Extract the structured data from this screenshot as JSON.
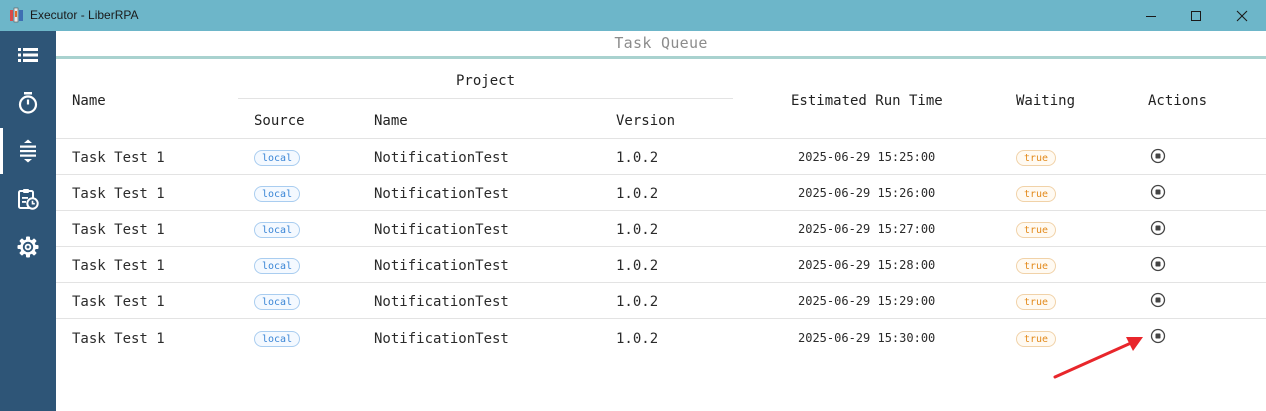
{
  "window": {
    "title": "Executor - LiberRPA",
    "app_icon": "liberrpa-logo-icon",
    "buttons": [
      "minimize-icon",
      "maximize-icon",
      "close-icon"
    ]
  },
  "sidebar": {
    "items": [
      {
        "icon": "list-icon",
        "active": false
      },
      {
        "icon": "timer-icon",
        "active": false
      },
      {
        "icon": "queue-icon",
        "active": true
      },
      {
        "icon": "schedule-clipboard-icon",
        "active": false
      },
      {
        "icon": "gear-icon",
        "active": false
      }
    ],
    "colors": {
      "background": "#2e5577",
      "icon": "#ffffff"
    }
  },
  "panel": {
    "title": "Task Queue"
  },
  "table": {
    "headers": {
      "name": "Name",
      "project": "Project",
      "source": "Source",
      "project_name": "Name",
      "version": "Version",
      "estimated_run_time": "Estimated Run Time",
      "waiting": "Waiting",
      "actions": "Actions"
    },
    "rows": [
      {
        "name": "Task Test 1",
        "source": "local",
        "project_name": "NotificationTest",
        "version": "1.0.2",
        "estimated_run_time": "2025-06-29 15:25:00",
        "waiting": "true",
        "action_icon": "stop-circle-icon"
      },
      {
        "name": "Task Test 1",
        "source": "local",
        "project_name": "NotificationTest",
        "version": "1.0.2",
        "estimated_run_time": "2025-06-29 15:26:00",
        "waiting": "true",
        "action_icon": "stop-circle-icon"
      },
      {
        "name": "Task Test 1",
        "source": "local",
        "project_name": "NotificationTest",
        "version": "1.0.2",
        "estimated_run_time": "2025-06-29 15:27:00",
        "waiting": "true",
        "action_icon": "stop-circle-icon"
      },
      {
        "name": "Task Test 1",
        "source": "local",
        "project_name": "NotificationTest",
        "version": "1.0.2",
        "estimated_run_time": "2025-06-29 15:28:00",
        "waiting": "true",
        "action_icon": "stop-circle-icon"
      },
      {
        "name": "Task Test 1",
        "source": "local",
        "project_name": "NotificationTest",
        "version": "1.0.2",
        "estimated_run_time": "2025-06-29 15:29:00",
        "waiting": "true",
        "action_icon": "stop-circle-icon"
      },
      {
        "name": "Task Test 1",
        "source": "local",
        "project_name": "NotificationTest",
        "version": "1.0.2",
        "estimated_run_time": "2025-06-29 15:30:00",
        "waiting": "true",
        "action_icon": "stop-circle-icon"
      }
    ]
  },
  "annotation": {
    "icon": "red-arrow-icon",
    "color": "#e8262b"
  },
  "colors": {
    "titlebar": "#6db6c9",
    "panel_title_underline": "#a9d2cf",
    "badge_local": "#3b86d6",
    "badge_true": "#e38b1d"
  }
}
